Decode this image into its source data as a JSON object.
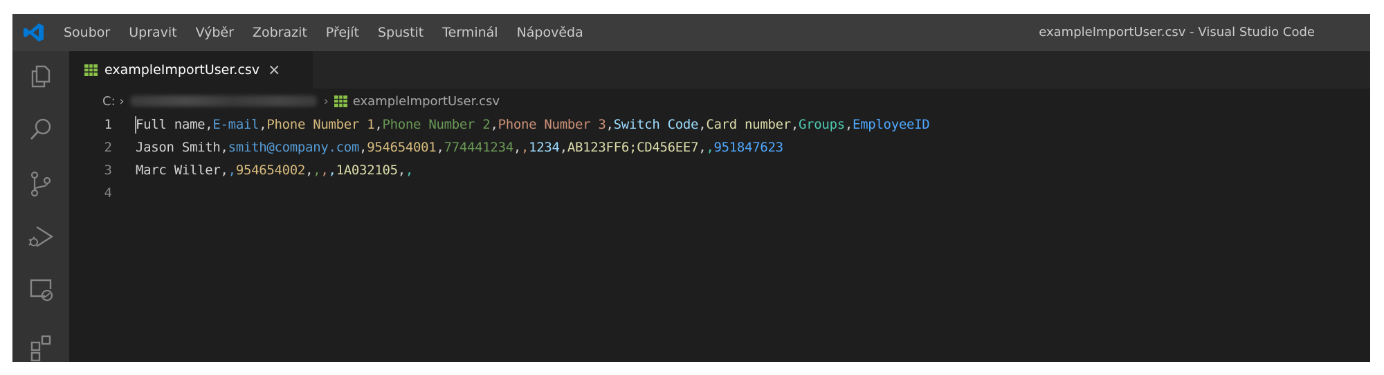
{
  "titlebar": {
    "menu": [
      "Soubor",
      "Upravit",
      "Výběr",
      "Zobrazit",
      "Přejít",
      "Spustit",
      "Terminál",
      "Nápověda"
    ],
    "window_title": "exampleImportUser.csv - Visual Studio Code"
  },
  "activity_bar": {
    "icons": [
      "explorer-icon",
      "search-icon",
      "source-control-icon",
      "run-debug-icon",
      "remote-explorer-icon",
      "extensions-icon"
    ]
  },
  "tab": {
    "label": "exampleImportUser.csv",
    "close": "×",
    "icon": "csv-file-icon"
  },
  "breadcrumb": {
    "drive": "C: ›",
    "separator": "›",
    "file": "exampleImportUser.csv"
  },
  "editor": {
    "lines": [
      {
        "number": "1",
        "tokens": [
          {
            "text": "Full name",
            "c": 0
          },
          {
            "text": ",",
            "c": 0
          },
          {
            "text": "E-mail",
            "c": 1
          },
          {
            "text": ",",
            "c": 0
          },
          {
            "text": "Phone Number 1",
            "c": 2
          },
          {
            "text": ",",
            "c": 0
          },
          {
            "text": "Phone Number 2",
            "c": 3
          },
          {
            "text": ",",
            "c": 0
          },
          {
            "text": "Phone Number 3",
            "c": 4
          },
          {
            "text": ",",
            "c": 0
          },
          {
            "text": "Switch Code",
            "c": 5
          },
          {
            "text": ",",
            "c": 0
          },
          {
            "text": "Card number",
            "c": 6
          },
          {
            "text": ",",
            "c": 0
          },
          {
            "text": "Groups",
            "c": 7
          },
          {
            "text": ",",
            "c": 0
          },
          {
            "text": "EmployeeID",
            "c": 8
          }
        ]
      },
      {
        "number": "2",
        "tokens": [
          {
            "text": "Jason Smith",
            "c": 0
          },
          {
            "text": ",",
            "c": 0
          },
          {
            "text": "smith@company.com",
            "c": 1
          },
          {
            "text": ",",
            "c": 0
          },
          {
            "text": "954654001",
            "c": 2
          },
          {
            "text": ",",
            "c": 0
          },
          {
            "text": "774441234",
            "c": 3
          },
          {
            "text": ",",
            "c": 0
          },
          {
            "text": "",
            "c": 4
          },
          {
            "text": ",",
            "c": 4
          },
          {
            "text": "1234",
            "c": 5
          },
          {
            "text": ",",
            "c": 0
          },
          {
            "text": "AB123FF6;CD456EE7",
            "c": 6
          },
          {
            "text": ",",
            "c": 0
          },
          {
            "text": "",
            "c": 7
          },
          {
            "text": ",",
            "c": 7
          },
          {
            "text": "951847623",
            "c": 8
          }
        ]
      },
      {
        "number": "3",
        "tokens": [
          {
            "text": "Marc Willer",
            "c": 0
          },
          {
            "text": ",",
            "c": 0
          },
          {
            "text": "",
            "c": 1
          },
          {
            "text": ",",
            "c": 1
          },
          {
            "text": "954654002",
            "c": 2
          },
          {
            "text": ",",
            "c": 0
          },
          {
            "text": "",
            "c": 3
          },
          {
            "text": ",",
            "c": 3
          },
          {
            "text": "",
            "c": 4
          },
          {
            "text": ",",
            "c": 4
          },
          {
            "text": "",
            "c": 5
          },
          {
            "text": ",",
            "c": 5
          },
          {
            "text": "1A032105",
            "c": 6
          },
          {
            "text": ",",
            "c": 0
          },
          {
            "text": "",
            "c": 7
          },
          {
            "text": ",",
            "c": 7
          }
        ]
      },
      {
        "number": "4",
        "tokens": []
      }
    ]
  },
  "colors": {
    "background": "#1e1e1e",
    "titlebar": "#3c3c3c",
    "activity_bar": "#333333",
    "vscode_blue": "#0078d4",
    "csv_icon": "#8bc34a"
  }
}
